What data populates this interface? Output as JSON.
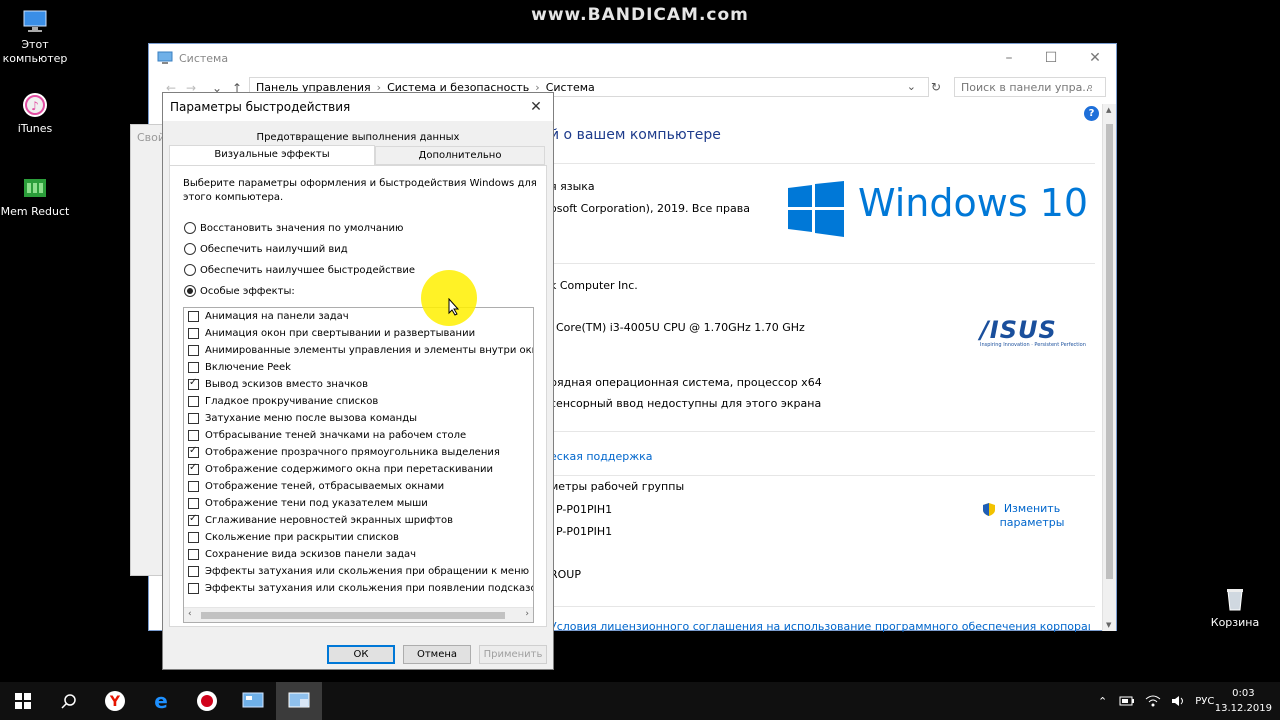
{
  "watermark": "www.BANDICAM.com",
  "desktop_icons": [
    {
      "label": "Этот компьютер"
    },
    {
      "label": "iTunes"
    },
    {
      "label": "Mem Reduct"
    },
    {
      "label": "Корзина"
    }
  ],
  "system_window": {
    "title": "Система",
    "breadcrumb": [
      "Панель управления",
      "Система и безопасность",
      "Система"
    ],
    "search_placeholder": "Поиск в панели упра...",
    "heading": "й о вашем компьютере",
    "lines": {
      "edition": "я языка",
      "copyright": "osoft Corporation), 2019. Все права",
      "manufacturer": "k Computer Inc.",
      "processor": "Core(TM) i3-4005U CPU @ 1.70GHz   1.70 GHz",
      "system_type": "рядная операционная система, процессор x64",
      "pen": "сенсорный ввод недоступны для этого экрана",
      "support_link": "еская поддержка",
      "workgroup_header": "метры рабочей группы",
      "computer_name": "P-P01PIH1",
      "full_name": "P-P01PIH1",
      "workgroup": "ROUP",
      "change_settings": "Изменить параметры",
      "license_link": "Условия лицензионного соглашения на использование программного обеспечения корпорации"
    },
    "windows_logo_text": "Windows 10",
    "asus_text": "/ISUS",
    "asus_tagline": "Inspiring Innovation · Persistent Perfection"
  },
  "dialog": {
    "title": "Параметры быстродействия",
    "tab_top": "Предотвращение выполнения данных",
    "tabs": [
      {
        "label": "Визуальные эффекты",
        "active": true
      },
      {
        "label": "Дополнительно",
        "active": false
      }
    ],
    "description": "Выберите параметры оформления и быстродействия Windows для этого компьютера.",
    "radios": [
      {
        "label": "Восстановить значения по умолчанию",
        "selected": false
      },
      {
        "label": "Обеспечить наилучший вид",
        "selected": false
      },
      {
        "label": "Обеспечить наилучшее быстродействие",
        "selected": false
      },
      {
        "label": "Особые эффекты:",
        "selected": true
      }
    ],
    "effects": [
      {
        "label": "Анимация на панели задач",
        "checked": false
      },
      {
        "label": "Анимация окон при свертывании и развертывании",
        "checked": false
      },
      {
        "label": "Анимированные элементы управления и элементы внутри окн",
        "checked": false
      },
      {
        "label": "Включение Peek",
        "checked": false
      },
      {
        "label": "Вывод эскизов вместо значков",
        "checked": true
      },
      {
        "label": "Гладкое прокручивание списков",
        "checked": false
      },
      {
        "label": "Затухание меню после вызова команды",
        "checked": false
      },
      {
        "label": "Отбрасывание теней значками на рабочем столе",
        "checked": false
      },
      {
        "label": "Отображение прозрачного прямоугольника выделения",
        "checked": true
      },
      {
        "label": "Отображение содержимого окна при перетаскивании",
        "checked": true
      },
      {
        "label": "Отображение теней, отбрасываемых окнами",
        "checked": false
      },
      {
        "label": "Отображение тени под указателем мыши",
        "checked": false
      },
      {
        "label": "Сглаживание неровностей экранных шрифтов",
        "checked": true
      },
      {
        "label": "Скольжение при раскрытии списков",
        "checked": false
      },
      {
        "label": "Сохранение вида эскизов панели задач",
        "checked": false
      },
      {
        "label": "Эффекты затухания или скольжения при обращении к меню",
        "checked": false
      },
      {
        "label": "Эффекты затухания или скольжения при появлении подсказок",
        "checked": false
      }
    ],
    "buttons": {
      "ok": "ОК",
      "cancel": "Отмена",
      "apply": "Применить"
    }
  },
  "taskbar": {
    "language": "РУС",
    "time": "0:03",
    "date": "13.12.2019"
  },
  "colors": {
    "accent": "#0078d7",
    "windows_blue": "#0078d7",
    "taskbar": "#101010"
  }
}
